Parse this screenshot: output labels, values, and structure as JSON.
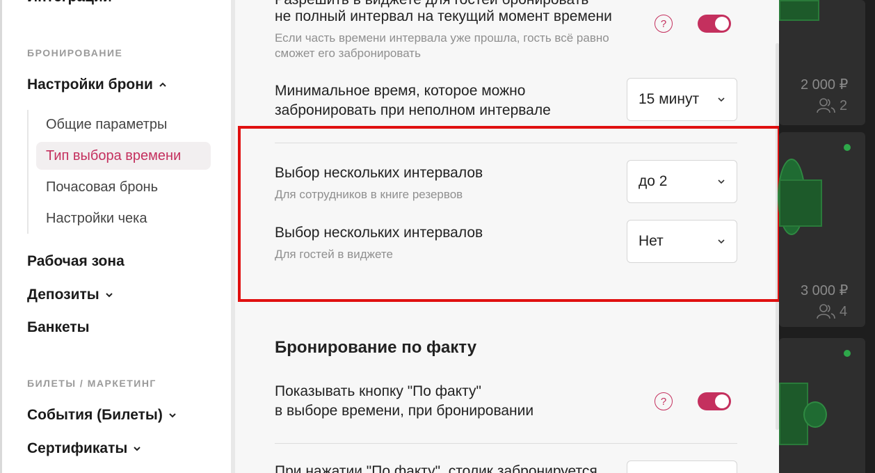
{
  "sidebar": {
    "top_item": "Интеграции",
    "section_booking": "БРОНИРОВАНИЕ",
    "booking_settings": "Настройки брони",
    "sub_items": [
      "Общие параметры",
      "Тип выбора времени",
      "Почасовая бронь",
      "Настройки чека"
    ],
    "active_sub": "Тип выбора времени",
    "work_zone": "Рабочая зона",
    "deposits": "Депозиты",
    "banquets": "Банкеты",
    "section_tickets": "БИЛЕТЫ / МАРКЕТИНГ",
    "events": "События (Билеты)",
    "certificates": "Сертификаты"
  },
  "main": {
    "row1": {
      "title_top": "Разрешить в виджете для гостей бронировать",
      "title_bottom": "не полный интервал на текущий момент времени",
      "desc_line1": "Если часть времени интервала уже прошла, гость всё равно",
      "desc_line2": "сможет его забронировать",
      "help": "?",
      "toggle_on": true
    },
    "row2": {
      "title_line1": "Минимальное время, которое можно",
      "title_line2": "забронировать при неполном интервале",
      "select_value": "15 минут"
    },
    "row3": {
      "title": "Выбор нескольких интервалов",
      "desc": "Для сотрудников в книге резервов",
      "select_value": "до 2"
    },
    "row4": {
      "title": "Выбор нескольких интервалов",
      "desc": "Для гостей в виджете",
      "select_value": "Нет"
    },
    "section_fact": "Бронирование по факту",
    "row5": {
      "title_line1": "Показывать кнопку \"По факту\"",
      "title_line2": "в выборе времени, при бронировании",
      "help": "?",
      "toggle_on": true
    },
    "row6": {
      "title": "При нажатии \"По факту\", столик забронируется"
    }
  },
  "right_panel": {
    "cards": [
      {
        "price": "2 000 ₽",
        "capacity": "2"
      },
      {
        "price": "3 000 ₽",
        "capacity": "4"
      }
    ]
  },
  "colors": {
    "accent": "#c4305e",
    "highlight": "#e01010",
    "table_green": "#1d5a2a"
  }
}
